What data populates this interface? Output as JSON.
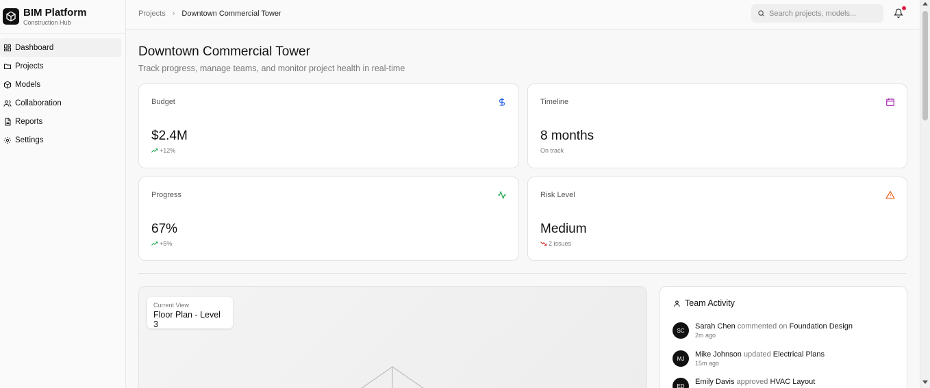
{
  "brand": {
    "title": "BIM Platform",
    "subtitle": "Construction Hub"
  },
  "nav": [
    {
      "label": "Dashboard",
      "icon": "dashboard-icon",
      "active": true
    },
    {
      "label": "Projects",
      "icon": "folder-icon"
    },
    {
      "label": "Models",
      "icon": "cube-icon"
    },
    {
      "label": "Collaboration",
      "icon": "users-icon"
    },
    {
      "label": "Reports",
      "icon": "file-icon"
    },
    {
      "label": "Settings",
      "icon": "gear-icon"
    }
  ],
  "breadcrumb": {
    "parent": "Projects",
    "separator": "›",
    "current": "Downtown Commercial Tower"
  },
  "search": {
    "placeholder": "Search projects, models..."
  },
  "notifications": {
    "icon": "bell-icon",
    "has_unread": true
  },
  "page": {
    "title": "Downtown Commercial Tower",
    "subtitle": "Track progress, manage teams, and monitor project health in real-time"
  },
  "stats": [
    {
      "label": "Budget",
      "value": "$2.4M",
      "delta": "+12%",
      "icon": "dollar-icon",
      "icon_color": "#2563eb",
      "trend": "up"
    },
    {
      "label": "Timeline",
      "value": "8 months",
      "delta": "On track",
      "icon": "calendar-icon",
      "icon_color": "#a21caf",
      "trend": "none"
    },
    {
      "label": "Progress",
      "value": "67%",
      "delta": "+5%",
      "icon": "activity-icon",
      "icon_color": "#16a34a",
      "trend": "up"
    },
    {
      "label": "Risk Level",
      "value": "Medium",
      "delta": "2 issues",
      "icon": "warning-icon",
      "icon_color": "#ea580c",
      "trend": "down"
    }
  ],
  "viewer": {
    "chip_label": "Current View",
    "chip_value": "Floor Plan - Level 3"
  },
  "activity": {
    "title": "Team Activity",
    "items": [
      {
        "initials": "SC",
        "user": "Sarah Chen",
        "verb": "commented on",
        "target": "Foundation Design",
        "time": "2m ago"
      },
      {
        "initials": "MJ",
        "user": "Mike Johnson",
        "verb": "updated",
        "target": "Electrical Plans",
        "time": "15m ago"
      },
      {
        "initials": "ED",
        "user": "Emily Davis",
        "verb": "approved",
        "target": "HVAC Layout",
        "time": ""
      }
    ]
  },
  "colors": {
    "accent": "#111111",
    "notification_dot": "#e11d48",
    "trend_up": "#16a34a",
    "trend_down": "#dc2626"
  }
}
